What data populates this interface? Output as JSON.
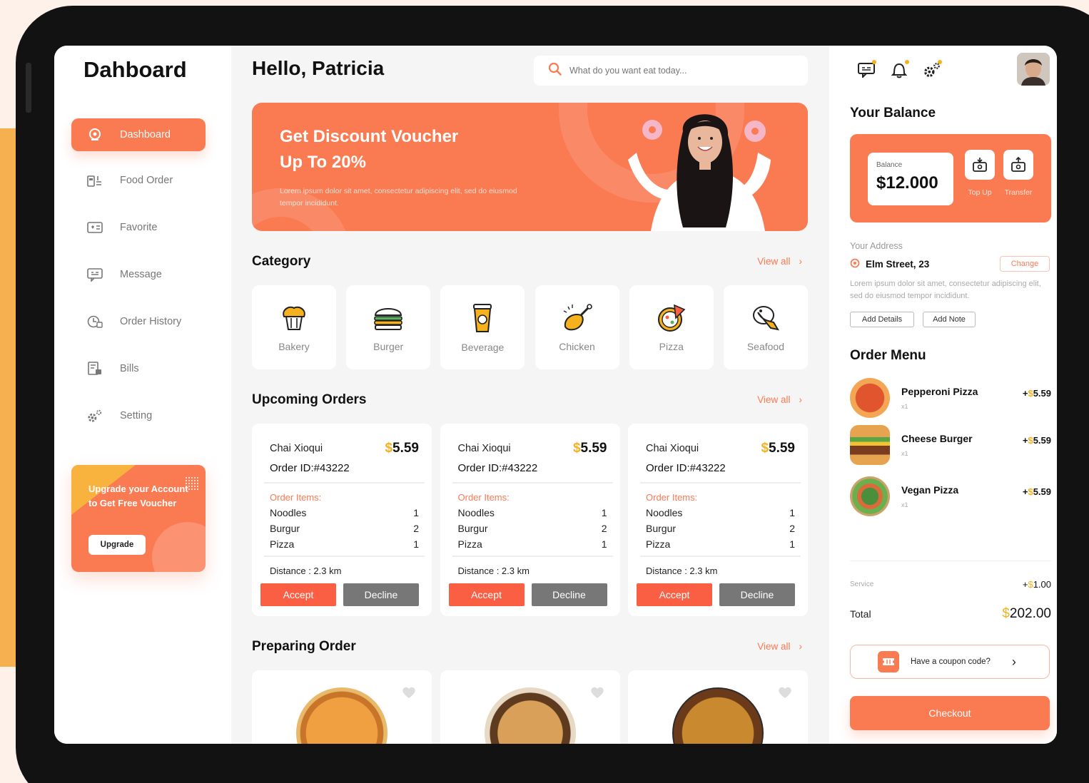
{
  "brand": "Dahboard",
  "sidebar": {
    "items": [
      {
        "label": "Dashboard"
      },
      {
        "label": "Food Order"
      },
      {
        "label": "Favorite"
      },
      {
        "label": "Message"
      },
      {
        "label": "Order History"
      },
      {
        "label": "Bills"
      },
      {
        "label": "Setting"
      }
    ],
    "upgrade": {
      "text": "Upgrade your Account to Get Free Voucher",
      "button": "Upgrade"
    }
  },
  "header": {
    "greeting": "Hello, Patricia",
    "search_placeholder": "What do you want eat today..."
  },
  "banner": {
    "title_line1": "Get Discount Voucher",
    "title_line2": "Up To 20%",
    "subtitle": "Lorem ipsum dolor sit amet, consectetur adipiscing elit, sed do eiusmod tempor incididunt."
  },
  "category": {
    "title": "Category",
    "view_all": "View all",
    "items": [
      {
        "label": "Bakery"
      },
      {
        "label": "Burger"
      },
      {
        "label": "Beverage"
      },
      {
        "label": "Chicken"
      },
      {
        "label": "Pizza"
      },
      {
        "label": "Seafood"
      }
    ]
  },
  "upcoming": {
    "title": "Upcoming Orders",
    "view_all": "View all",
    "orders": [
      {
        "name": "Chai Xioqui",
        "currency": "$",
        "price": "5.59",
        "order_id": "Order ID:#43222",
        "items_label": "Order Items:",
        "items": [
          {
            "name": "Noodles",
            "qty": "1"
          },
          {
            "name": "Burgur",
            "qty": "2"
          },
          {
            "name": "Pizza",
            "qty": "1"
          }
        ],
        "distance": "Distance : 2.3 km",
        "accept": "Accept",
        "decline": "Decline"
      },
      {
        "name": "Chai Xioqui",
        "currency": "$",
        "price": "5.59",
        "order_id": "Order ID:#43222",
        "items_label": "Order Items:",
        "items": [
          {
            "name": "Noodles",
            "qty": "1"
          },
          {
            "name": "Burgur",
            "qty": "2"
          },
          {
            "name": "Pizza",
            "qty": "1"
          }
        ],
        "distance": "Distance : 2.3 km",
        "accept": "Accept",
        "decline": "Decline"
      },
      {
        "name": "Chai Xioqui",
        "currency": "$",
        "price": "5.59",
        "order_id": "Order ID:#43222",
        "items_label": "Order Items:",
        "items": [
          {
            "name": "Noodles",
            "qty": "1"
          },
          {
            "name": "Burgur",
            "qty": "2"
          },
          {
            "name": "Pizza",
            "qty": "1"
          }
        ],
        "distance": "Distance : 2.3 km",
        "accept": "Accept",
        "decline": "Decline"
      }
    ]
  },
  "preparing": {
    "title": "Preparing Order",
    "view_all": "View all"
  },
  "balance": {
    "title": "Your Balance",
    "label": "Balance",
    "amount": "$12.000",
    "top_up": "Top Up",
    "transfer": "Transfer"
  },
  "address": {
    "label": "Your Address",
    "street": "Elm Street, 23",
    "change": "Change",
    "description": "Lorem ipsum dolor sit amet, consectetur adipiscing elit, sed do eiusmod tempor incididunt.",
    "add_details": "Add Details",
    "add_note": "Add Note"
  },
  "order_menu": {
    "title": "Order Menu",
    "items": [
      {
        "name": "Pepperoni Pizza",
        "qty": "x1",
        "plus": "+",
        "currency": "$",
        "price": "5.59"
      },
      {
        "name": "Cheese Burger",
        "qty": "x1",
        "plus": "+",
        "currency": "$",
        "price": "5.59"
      },
      {
        "name": "Vegan Pizza",
        "qty": "x1",
        "plus": "+",
        "currency": "$",
        "price": "5.59"
      }
    ],
    "service_label": "Service",
    "service_plus": "+",
    "service_currency": "$",
    "service_value": "1.00",
    "total_label": "Total",
    "total_currency": "$",
    "total_value": "202.00",
    "coupon": "Have a coupon code?",
    "checkout": "Checkout"
  },
  "colors": {
    "accent": "#fa7a52",
    "yellow": "#f5b21e",
    "decline": "#777777"
  }
}
